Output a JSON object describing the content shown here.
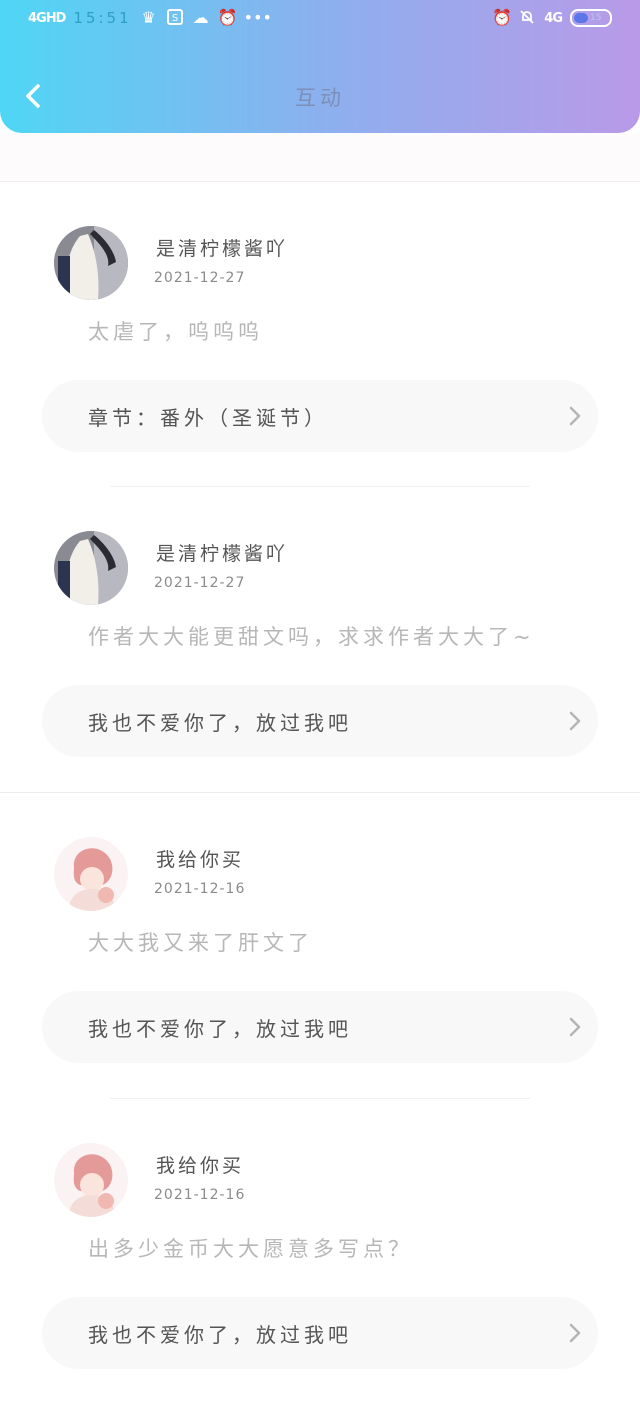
{
  "status_bar": {
    "network": "4GHD",
    "time": "15:51",
    "network_right": "4G",
    "battery": "15"
  },
  "header": {
    "title": "互动"
  },
  "comments": [
    {
      "username": "是清柠檬酱吖",
      "date": "2021-12-27",
      "text": "太虐了，呜呜呜",
      "target": "章节：番外（圣诞节）",
      "avatar": "avatar-girl-icon"
    },
    {
      "username": "是清柠檬酱吖",
      "date": "2021-12-27",
      "text": "作者大大能更甜文吗，求求作者大大了~",
      "target": "我也不爱你了，放过我吧",
      "avatar": "avatar-girl-icon"
    },
    {
      "username": "我给你买",
      "date": "2021-12-16",
      "text": "大大我又来了肝文了",
      "target": "我也不爱你了，放过我吧",
      "avatar": "avatar-anime-icon"
    },
    {
      "username": "我给你买",
      "date": "2021-12-16",
      "text": "出多少金币大大愿意多写点？",
      "target": "我也不爱你了，放过我吧",
      "avatar": "avatar-anime-icon"
    }
  ],
  "colors": {
    "header_start": "#4fd6f5",
    "header_end": "#b99ae8",
    "pill_bg": "#f8f8f8"
  }
}
